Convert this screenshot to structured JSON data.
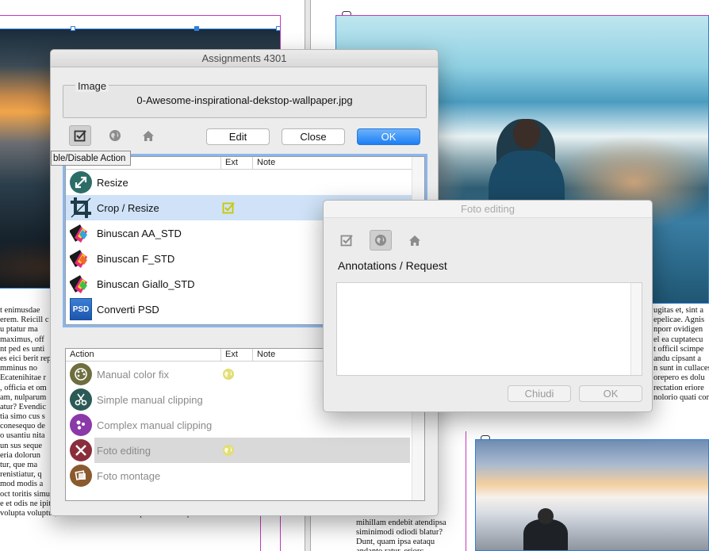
{
  "background": {
    "left_text_lines": [
      "t enimusdae",
      "erem. Reicill c",
      "u ptatur ma",
      "maximus, off",
      "nt ped es unti",
      "es eici berit rep",
      "mminus no",
      "Ecatenihitae r",
      ", officia et om",
      "am, nulparum",
      "atur? Evendic",
      "tia simo cus s",
      "conesequo de",
      "o usantiu nita",
      "un sus seque",
      "eria dolorun",
      "tur, que ma",
      "renistiatur, q",
      "mod modis a",
      "oct toritis simus, quos de enit voluptae vere cum ut antiant quatectem",
      "e et odis ne ipiti il mo ipsum ea pernam res qui torepudae officiu re-",
      "volupta voluptur, ut as rehendandus mincipition corum que cus aut"
    ],
    "right_text_lines": [
      "ugitas et, sint a",
      "epelicae. Agnis",
      "nporr ovidigen",
      "el ea cuptatecu",
      "t officil scimpe",
      "andu cipsant a",
      "n sunt in cullaces",
      "orepero es dolu",
      "rectation eriore",
      "nolorio quati corepudam aceperibus et, inver imporeo blame essitis es"
    ],
    "col_text_lines": [
      "itis mo",
      "ang ni-",
      "um eos",
      "aliquc",
      "cora",
      "cend-",
      "ese dit",
      "e de di",
      "atur t",
      "mihillam endebit atendipsa",
      "siminimodi odiodi blatur?",
      "Dunt, quam ipsa eataqu",
      "andanto ratur, eriorc"
    ]
  },
  "assign_dialog": {
    "title": "Assignments 4301",
    "image_group_label": "Image",
    "filename": "0-Awesome-inspirational-dekstop-wallpaper.jpg",
    "buttons": {
      "edit": "Edit",
      "close": "Close",
      "ok": "OK"
    },
    "tooltip": "ble/Disable Action",
    "columns": {
      "action": "Action",
      "ext": "Ext",
      "note": "Note"
    },
    "top_list": [
      {
        "label": "Resize",
        "icon": "resize-icon",
        "ext": ""
      },
      {
        "label": "Crop / Resize",
        "icon": "crop-icon",
        "ext": "checked",
        "selected": true
      },
      {
        "label": "Binuscan AA_STD",
        "icon": "binuscan-icon",
        "ext": ""
      },
      {
        "label": "Binuscan F_STD",
        "icon": "binuscan-icon",
        "ext": ""
      },
      {
        "label": "Binuscan Giallo_STD",
        "icon": "binuscan-icon",
        "ext": ""
      },
      {
        "label": "Converti PSD",
        "icon": "psd-icon",
        "ext": ""
      }
    ],
    "psd_badge": "PSD",
    "bottom_list": [
      {
        "label": "Manual color fix",
        "icon": "palette-icon",
        "ext": "globe",
        "color": "#6e6e3e"
      },
      {
        "label": "Simple manual clipping",
        "icon": "scissors-icon",
        "ext": "",
        "color": "#2c5a56"
      },
      {
        "label": "Complex manual clipping",
        "icon": "scissors-icon",
        "ext": "",
        "color": "#8b38a8"
      },
      {
        "label": "Foto editing",
        "icon": "tools-icon",
        "ext": "globe",
        "color": "#8a2e3c",
        "selected": true
      },
      {
        "label": "Foto montage",
        "icon": "photos-icon",
        "ext": "",
        "color": "#8a5a2e"
      }
    ]
  },
  "foto_dialog": {
    "title": "Foto editing",
    "label": "Annotations / Request",
    "buttons": {
      "chiudi": "Chiudi",
      "ok": "OK"
    }
  },
  "colors": {
    "accent": "#1c7ef5",
    "selection": "#cfe2f7",
    "ext_check": "#c8c800",
    "margin_guide": "#c13ac1"
  }
}
